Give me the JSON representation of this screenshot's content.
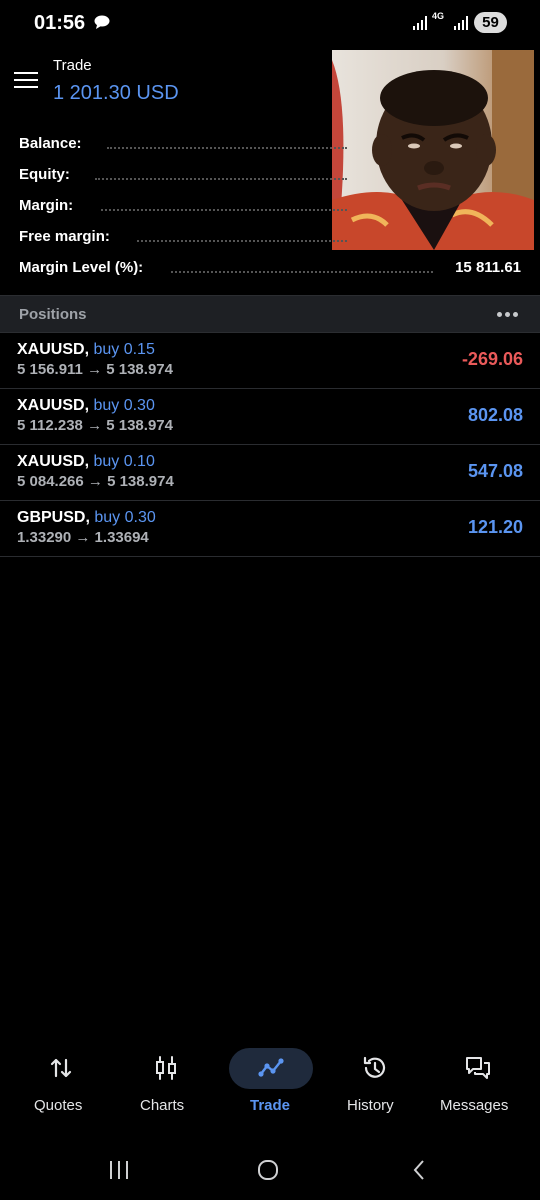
{
  "status_bar": {
    "time": "01:56",
    "network": "4G",
    "battery": "59"
  },
  "header": {
    "title": "Trade",
    "balance": "1 201.30 USD"
  },
  "account": [
    {
      "label": "Balance:",
      "value": ""
    },
    {
      "label": "Equity:",
      "value": ""
    },
    {
      "label": "Margin:",
      "value": ""
    },
    {
      "label": "Free margin:",
      "value": ""
    },
    {
      "label": "Margin Level (%):",
      "value": "15 811.61"
    }
  ],
  "positions": {
    "title": "Positions",
    "items": [
      {
        "symbol": "XAUUSD,",
        "side": "buy 0.15",
        "prices": "5 156.911 → 5 138.974",
        "profit": "-269.06",
        "profit_color": "#ea5a5a"
      },
      {
        "symbol": "XAUUSD,",
        "side": "buy 0.30",
        "prices": "5 112.238 → 5 138.974",
        "profit": "802.08",
        "profit_color": "#5b95f1"
      },
      {
        "symbol": "XAUUSD,",
        "side": "buy 0.10",
        "prices": "5 084.266 → 5 138.974",
        "profit": "547.08",
        "profit_color": "#5b95f1"
      },
      {
        "symbol": "GBPUSD,",
        "side": "buy 0.30",
        "prices": "1.33290 → 1.33694",
        "profit": "121.20",
        "profit_color": "#5b95f1"
      }
    ]
  },
  "nav": {
    "items": [
      {
        "label": "Quotes",
        "icon": "quotes-icon"
      },
      {
        "label": "Charts",
        "icon": "candlestick-icon"
      },
      {
        "label": "Trade",
        "icon": "trade-icon",
        "active": true
      },
      {
        "label": "History",
        "icon": "history-icon"
      },
      {
        "label": "Messages",
        "icon": "messages-icon"
      }
    ],
    "active_color": "#5b95f1"
  },
  "colors": {
    "background": "#000000",
    "accent": "#5b95f1",
    "loss": "#ea5a5a",
    "section_header": "#1e2024"
  }
}
